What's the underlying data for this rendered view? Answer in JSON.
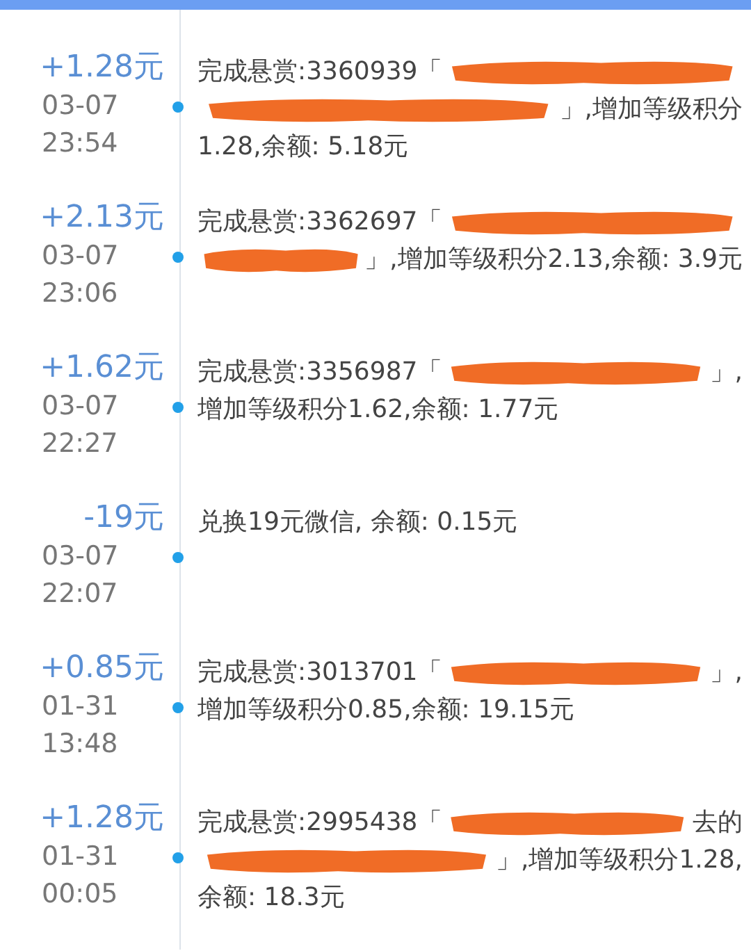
{
  "entries": [
    {
      "amount": "+1.28元",
      "date": "03-07",
      "time": "23:54",
      "lines": [
        [
          {
            "kind": "text",
            "text": "完成悬赏:3360939「"
          },
          {
            "kind": "redacted"
          }
        ],
        [
          {
            "kind": "redacted"
          },
          {
            "kind": "text",
            "text": "」,增加等级积分"
          }
        ],
        [
          {
            "kind": "text",
            "text": "1.28,余额: 5.18元"
          }
        ]
      ]
    },
    {
      "amount": "+2.13元",
      "date": "03-07",
      "time": "23:06",
      "lines": [
        [
          {
            "kind": "text",
            "text": "完成悬赏:3362697「"
          },
          {
            "kind": "redacted"
          }
        ],
        [
          {
            "kind": "redacted"
          },
          {
            "kind": "text",
            "text": "」,增加等级积分2.13,余额: 3.9元"
          }
        ]
      ]
    },
    {
      "amount": "+1.62元",
      "date": "03-07",
      "time": "22:27",
      "lines": [
        [
          {
            "kind": "text",
            "text": "完成悬赏:3356987「"
          },
          {
            "kind": "redacted"
          },
          {
            "kind": "text",
            "text": "」,"
          }
        ],
        [
          {
            "kind": "text",
            "text": "增加等级积分1.62,余额: 1.77元"
          }
        ]
      ]
    },
    {
      "amount": "-19元",
      "date": "03-07",
      "time": "22:07",
      "lines": [
        [
          {
            "kind": "text",
            "text": "兑换19元微信, 余额: 0.15元"
          }
        ]
      ]
    },
    {
      "amount": "+0.85元",
      "date": "01-31",
      "time": "13:48",
      "lines": [
        [
          {
            "kind": "text",
            "text": "完成悬赏:3013701「"
          },
          {
            "kind": "redacted"
          },
          {
            "kind": "text",
            "text": "」,"
          }
        ],
        [
          {
            "kind": "text",
            "text": "增加等级积分0.85,余额: 19.15元"
          }
        ]
      ]
    },
    {
      "amount": "+1.28元",
      "date": "01-31",
      "time": "00:05",
      "lines": [
        [
          {
            "kind": "text",
            "text": "完成悬赏:2995438「"
          },
          {
            "kind": "redacted"
          },
          {
            "kind": "text",
            "text": "去的"
          }
        ],
        [
          {
            "kind": "redacted"
          },
          {
            "kind": "text",
            "text": "」,增加等级积分1.28,"
          }
        ],
        [
          {
            "kind": "text",
            "text": "余额: 18.3元"
          }
        ]
      ]
    }
  ]
}
